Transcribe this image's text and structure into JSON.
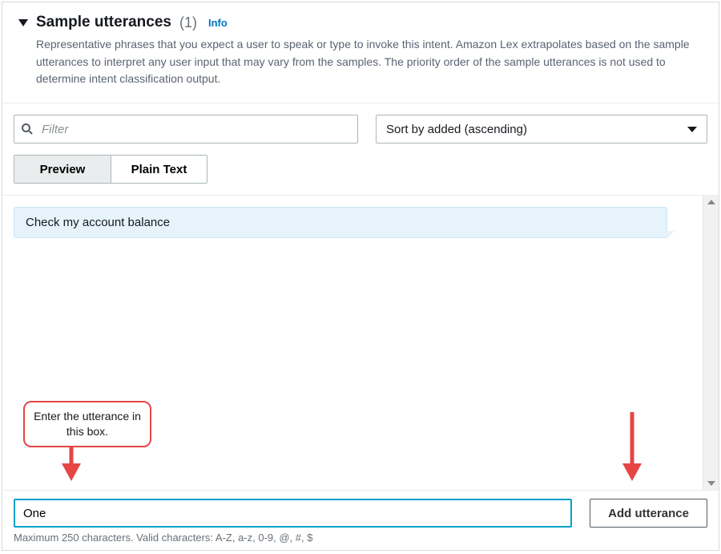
{
  "header": {
    "title": "Sample utterances",
    "count": "(1)",
    "info": "Info",
    "description": "Representative phrases that you expect a user to speak or type to invoke this intent. Amazon Lex extrapolates based on the sample utterances to interpret any user input that may vary from the samples. The priority order of the sample utterances is not used to determine intent classification output."
  },
  "controls": {
    "filter_placeholder": "Filter",
    "sort_label": "Sort by added (ascending)",
    "tabs": {
      "preview": "Preview",
      "plain": "Plain Text"
    }
  },
  "utterances": {
    "items": [
      {
        "text": "Check my account balance"
      }
    ]
  },
  "annotations": {
    "callout_text": "Enter the utterance in this box."
  },
  "footer": {
    "input_value": "One",
    "add_label": "Add utterance",
    "hint": "Maximum 250 characters. Valid characters: A-Z, a-z, 0-9, @, #, $"
  }
}
